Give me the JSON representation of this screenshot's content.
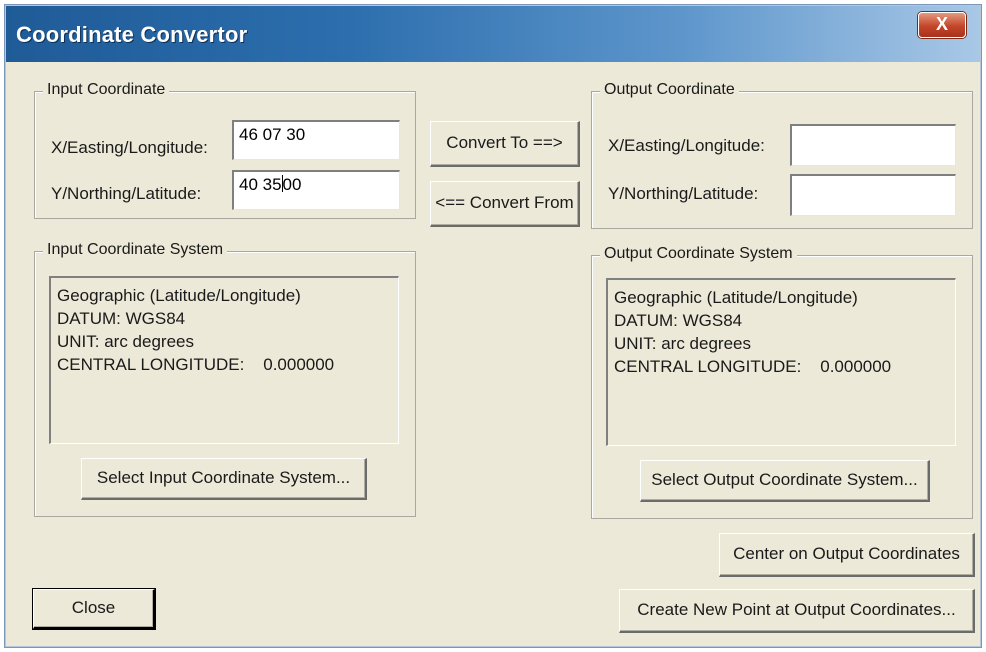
{
  "window": {
    "title": "Coordinate Convertor",
    "close_glyph": "X"
  },
  "input_coordinate": {
    "group_label": "Input Coordinate",
    "x_label": "X/Easting/Longitude:",
    "x_value": "46 07 30",
    "y_label": "Y/Northing/Latitude:",
    "y_value_before_caret": "40 35",
    "y_value_after_caret": "00"
  },
  "convert_buttons": {
    "to_label": "Convert To ==>",
    "from_label": "<== Convert From"
  },
  "output_coordinate": {
    "group_label": "Output Coordinate",
    "x_label": "X/Easting/Longitude:",
    "x_value": "",
    "y_label": "Y/Northing/Latitude:",
    "y_value": ""
  },
  "input_system": {
    "group_label": "Input Coordinate System",
    "lines": [
      "Geographic (Latitude/Longitude)",
      "DATUM: WGS84",
      "UNIT: arc degrees",
      "CENTRAL LONGITUDE:    0.000000"
    ],
    "select_button": "Select Input Coordinate System..."
  },
  "output_system": {
    "group_label": "Output Coordinate System",
    "lines": [
      "Geographic (Latitude/Longitude)",
      "DATUM: WGS84",
      "UNIT: arc degrees",
      "CENTRAL LONGITUDE:    0.000000"
    ],
    "select_button": "Select Output Coordinate System..."
  },
  "actions": {
    "center_label": "Center on Output Coordinates",
    "create_point_label": "Create New Point at Output Coordinates...",
    "close_label": "Close"
  }
}
